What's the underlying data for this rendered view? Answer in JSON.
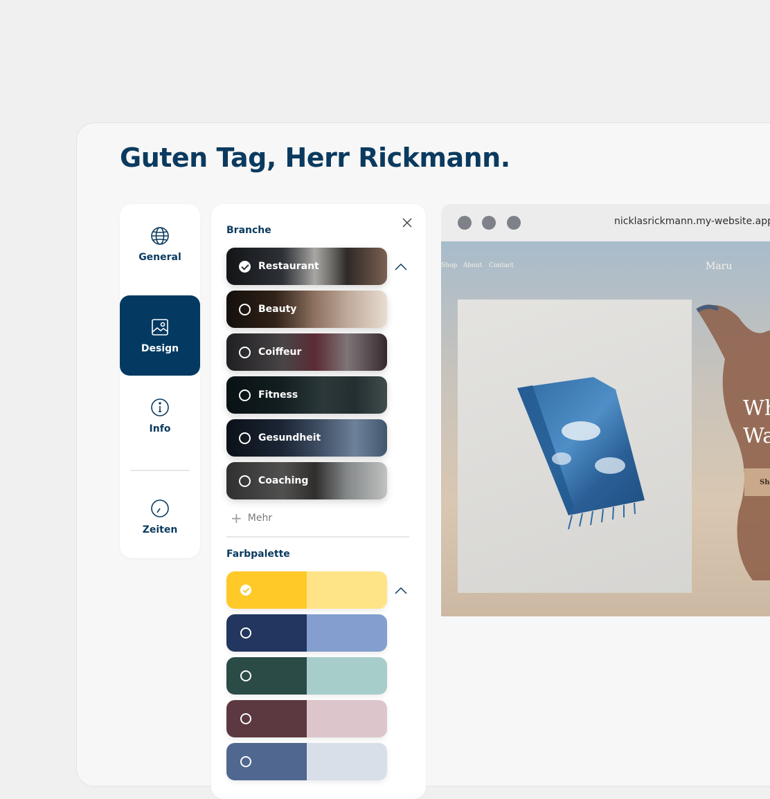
{
  "greeting": "Guten Tag, Herr Rickmann.",
  "nav": {
    "items": [
      {
        "label": "General",
        "icon": "globe-icon"
      },
      {
        "label": "Design",
        "icon": "image-icon",
        "active": true
      },
      {
        "label": "Info",
        "icon": "info-icon"
      },
      {
        "label": "Zeiten",
        "icon": "clock-icon"
      }
    ]
  },
  "branche": {
    "title": "Branche",
    "options": [
      {
        "label": "Restaurant",
        "checked": true
      },
      {
        "label": "Beauty",
        "checked": false
      },
      {
        "label": "Coiffeur",
        "checked": false
      },
      {
        "label": "Fitness",
        "checked": false
      },
      {
        "label": "Gesundheit",
        "checked": false
      },
      {
        "label": "Coaching",
        "checked": false
      }
    ],
    "more_label": "Mehr"
  },
  "farbpalette": {
    "title": "Farbpalette",
    "palettes": [
      {
        "primary": "#ffc928",
        "secondary": "#ffe487",
        "checked": true
      },
      {
        "primary": "#23365f",
        "secondary": "#849fcf",
        "checked": false
      },
      {
        "primary": "#2b4b47",
        "secondary": "#a7cdca",
        "checked": false
      },
      {
        "primary": "#5c3941",
        "secondary": "#dcc6cb",
        "checked": false
      },
      {
        "primary": "#50678f",
        "secondary": "#d8dfe9",
        "checked": false
      }
    ]
  },
  "browser": {
    "url": "nicklasrickmann.my-website.app"
  },
  "site": {
    "nav_links": [
      "Shop",
      "About",
      "Contact"
    ],
    "brand": "Maru",
    "hero_line1": "Wh",
    "hero_line2": "Wa",
    "button": "Sho"
  },
  "colors": {
    "brand_dark": "#043a62",
    "text_dark": "#0a3a5f"
  }
}
